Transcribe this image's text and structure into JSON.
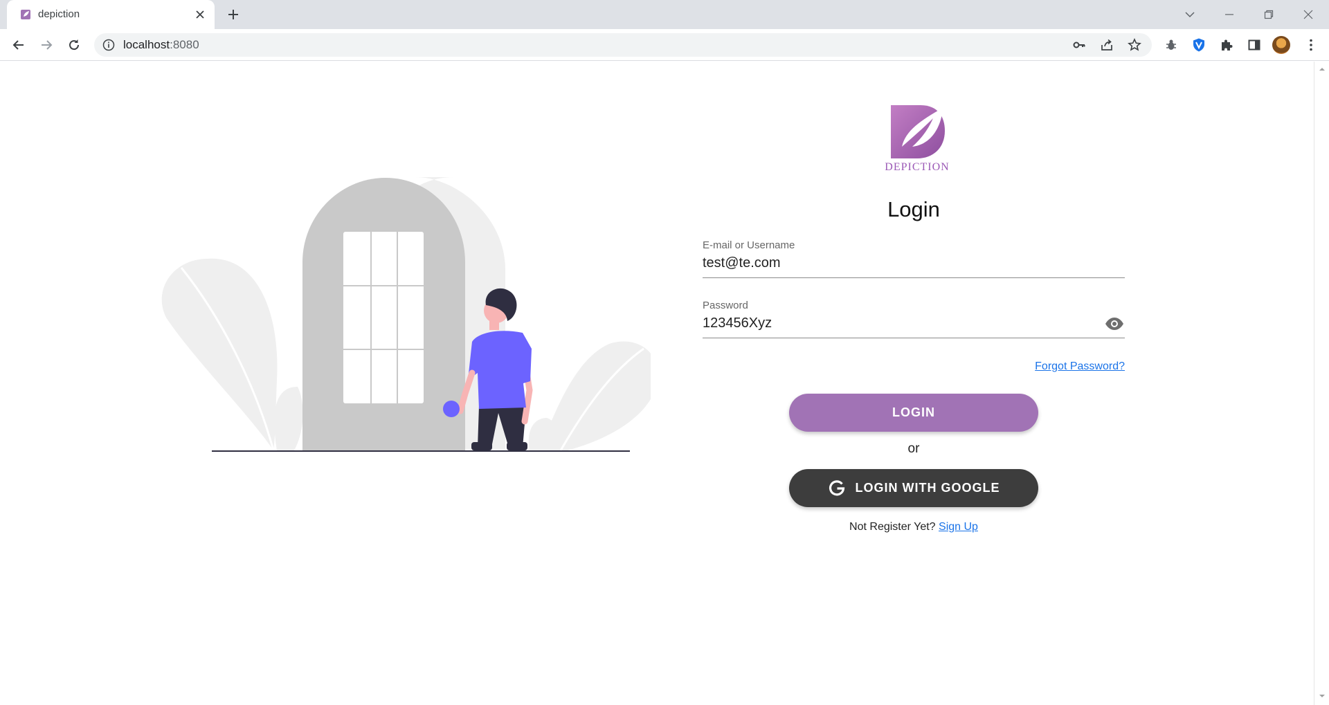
{
  "browser": {
    "tab_title": "depiction",
    "url_host": "localhost",
    "url_port": ":8080"
  },
  "icons": {
    "back": "arrow-left-icon",
    "forward": "arrow-right-icon",
    "reload": "reload-icon",
    "info": "info-icon",
    "key": "key-icon",
    "share": "share-icon",
    "star": "star-icon",
    "bug": "bug-icon",
    "shield": "shield-icon",
    "extensions": "puzzle-icon",
    "sidepanel": "side-panel-icon",
    "menu": "kebab-menu-icon",
    "visibility": "eye-icon",
    "google": "google-g-icon"
  },
  "brand": {
    "logo_text": "DEPICTION",
    "accent": "#a173b5",
    "dark": "#3d3d3d",
    "link": "#1a73e8"
  },
  "login": {
    "heading": "Login",
    "email_label": "E-mail or Username",
    "email_value": "test@te.com",
    "password_label": "Password",
    "password_value": "123456Xyz",
    "forgot_link": "Forgot Password?",
    "login_button": "LOGIN",
    "or_text": "or",
    "google_button": "LOGIN WITH GOOGLE",
    "signup_prompt": "Not Register Yet?",
    "signup_link": "Sign Up"
  }
}
